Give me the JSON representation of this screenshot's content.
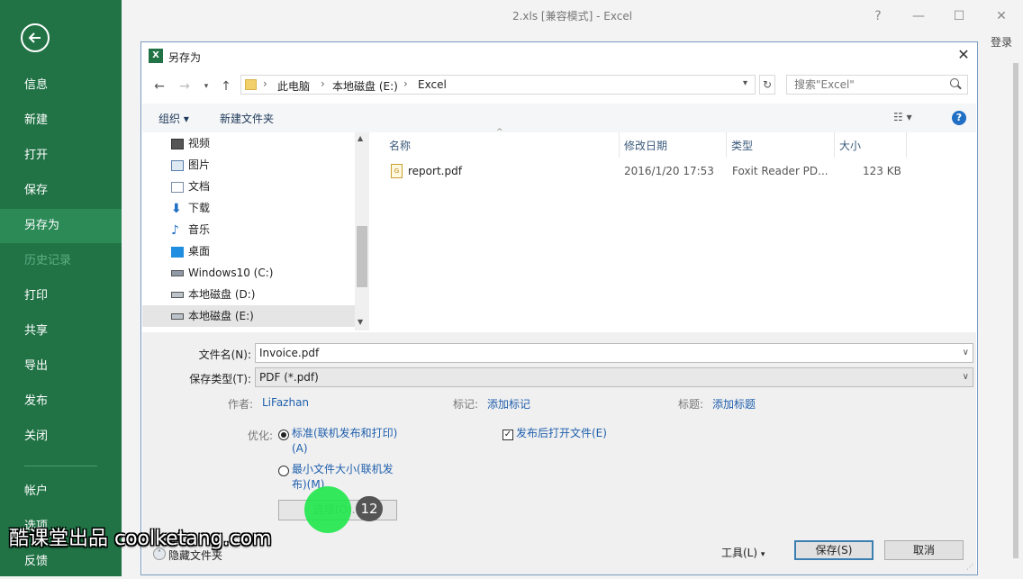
{
  "app": {
    "title": "2.xls  [兼容模式] - Excel",
    "help": "?",
    "login": "登录"
  },
  "sidebar": {
    "items": [
      {
        "label": "信息"
      },
      {
        "label": "新建"
      },
      {
        "label": "打开"
      },
      {
        "label": "保存"
      },
      {
        "label": "另存为"
      },
      {
        "label": "历史记录"
      },
      {
        "label": "打印"
      },
      {
        "label": "共享"
      },
      {
        "label": "导出"
      },
      {
        "label": "发布"
      },
      {
        "label": "关闭"
      },
      {
        "label": "帐户"
      },
      {
        "label": "选项"
      },
      {
        "label": "反馈"
      }
    ],
    "active": "另存为",
    "disabled": "历史记录",
    "brand_color": "#217346"
  },
  "dialog": {
    "title": "另存为",
    "breadcrumb": [
      "此电脑",
      "本地磁盘 (E:)",
      "Excel"
    ],
    "search_placeholder": "搜索\"Excel\"",
    "toolbar": {
      "organize": "组织 ▾",
      "new_folder": "新建文件夹"
    },
    "nav_items": [
      {
        "label": "视频",
        "icon": "video-icon"
      },
      {
        "label": "图片",
        "icon": "picture-icon"
      },
      {
        "label": "文档",
        "icon": "document-icon"
      },
      {
        "label": "下载",
        "icon": "download-icon"
      },
      {
        "label": "音乐",
        "icon": "music-icon"
      },
      {
        "label": "桌面",
        "icon": "desktop-icon"
      },
      {
        "label": "Windows10 (C:)",
        "icon": "drive-icon"
      },
      {
        "label": "本地磁盘 (D:)",
        "icon": "drive-icon"
      },
      {
        "label": "本地磁盘 (E:)",
        "icon": "drive-icon",
        "selected": true
      }
    ],
    "columns": [
      "名称",
      "修改日期",
      "类型",
      "大小"
    ],
    "files": [
      {
        "name": "report.pdf",
        "modified": "2016/1/20 17:53",
        "type": "Foxit Reader PD...",
        "size": "123 KB"
      }
    ],
    "form": {
      "filename_label": "文件名(N):",
      "filename_value": "Invoice.pdf",
      "filetype_label": "保存类型(T):",
      "filetype_value": "PDF (*.pdf)",
      "author_label": "作者:",
      "author_value": "LiFazhan",
      "tags_label": "标记:",
      "tags_value": "添加标记",
      "title_label": "标题:",
      "title_value": "添加标题",
      "optimize_label": "优化:",
      "opt_standard_1": "标准(联机发布和打印)",
      "opt_standard_2": "(A)",
      "opt_min_1": "最小文件大小(联机发",
      "opt_min_2": "布)(M)",
      "open_after": "发布后打开文件(E)",
      "options_btn": "选项(O)...",
      "hide_folders": "隐藏文件夹",
      "tools": "工具(L)",
      "save": "保存(S)",
      "cancel": "取消"
    }
  },
  "overlay": {
    "step": "12",
    "watermark": "酷课堂出品 coolketang.com"
  }
}
